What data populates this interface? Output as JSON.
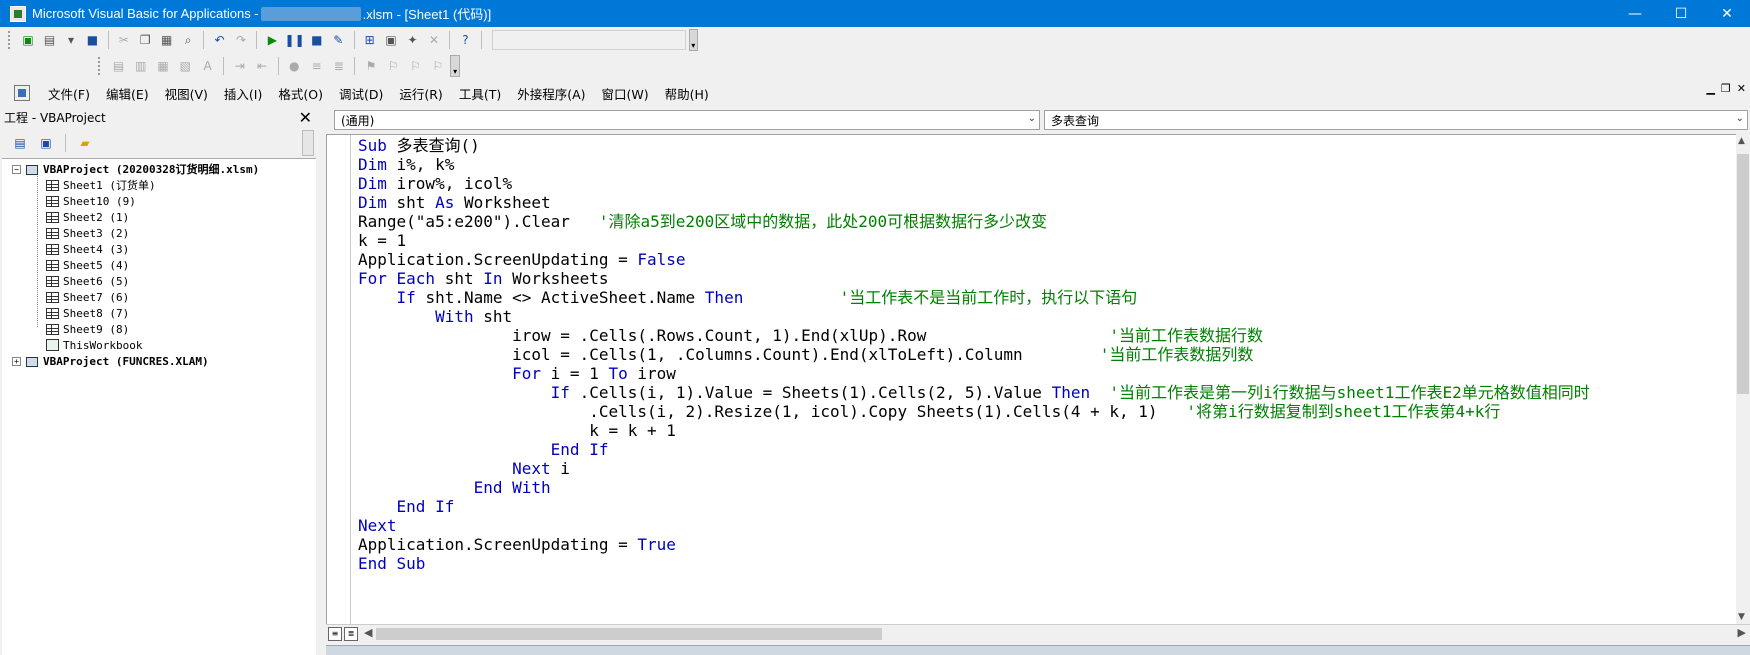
{
  "window": {
    "title_prefix": "Microsoft Visual Basic for Applications - ",
    "title_suffix": ".xlsm - [Sheet1 (代码)]",
    "min": "—",
    "max": "☐",
    "close": "✕"
  },
  "menu": {
    "items": [
      "文件(F)",
      "编辑(E)",
      "视图(V)",
      "插入(I)",
      "格式(O)",
      "调试(D)",
      "运行(R)",
      "工具(T)",
      "外接程序(A)",
      "窗口(W)",
      "帮助(H)"
    ]
  },
  "project": {
    "title": "工程 - VBAProject",
    "close": "✕",
    "root1": "VBAProject (20200328订货明细.xlsm)",
    "sheets": [
      "Sheet1 (订货单)",
      "Sheet10 (9)",
      "Sheet2 (1)",
      "Sheet3 (2)",
      "Sheet4 (3)",
      "Sheet5 (4)",
      "Sheet6 (5)",
      "Sheet7 (6)",
      "Sheet8 (7)",
      "Sheet9 (8)"
    ],
    "workbook": "ThisWorkbook",
    "root2": "VBAProject (FUNCRES.XLAM)"
  },
  "code": {
    "object_combo": "(通用)",
    "proc_combo": "多表查询",
    "lines": [
      [
        [
          "kw",
          "Sub "
        ],
        [
          "txt",
          "多表查询()"
        ]
      ],
      [
        [
          "kw",
          "Dim "
        ],
        [
          "txt",
          "i%, k%"
        ]
      ],
      [
        [
          "kw",
          "Dim "
        ],
        [
          "txt",
          "irow%, icol%"
        ]
      ],
      [
        [
          "kw",
          "Dim "
        ],
        [
          "txt",
          "sht "
        ],
        [
          "kw",
          "As "
        ],
        [
          "txt",
          "Worksheet"
        ]
      ],
      [
        [
          "txt",
          "Range(\"a5:e200\").Clear   "
        ],
        [
          "cmt",
          "'清除a5到e200区域中的数据，此处200可根据数据行多少改变"
        ]
      ],
      [
        [
          "txt",
          "k = 1"
        ]
      ],
      [
        [
          "txt",
          "Application.ScreenUpdating = "
        ],
        [
          "kw",
          "False"
        ]
      ],
      [
        [
          "kw",
          "For Each "
        ],
        [
          "txt",
          "sht "
        ],
        [
          "kw",
          "In "
        ],
        [
          "txt",
          "Worksheets"
        ]
      ],
      [
        [
          "txt",
          "    "
        ],
        [
          "kw",
          "If "
        ],
        [
          "txt",
          "sht.Name <> ActiveSheet.Name "
        ],
        [
          "kw",
          "Then"
        ],
        [
          "txt",
          "          "
        ],
        [
          "cmt",
          "'当工作表不是当前工作时，执行以下语句"
        ]
      ],
      [
        [
          "txt",
          "        "
        ],
        [
          "kw",
          "With "
        ],
        [
          "txt",
          "sht"
        ]
      ],
      [
        [
          "txt",
          "                irow = .Cells(.Rows.Count, 1).End(xlUp).Row                   "
        ],
        [
          "cmt",
          "'当前工作表数据行数"
        ]
      ],
      [
        [
          "txt",
          "                icol = .Cells(1, .Columns.Count).End(xlToLeft).Column        "
        ],
        [
          "cmt",
          "'当前工作表数据列数"
        ]
      ],
      [
        [
          "txt",
          "                "
        ],
        [
          "kw",
          "For "
        ],
        [
          "txt",
          "i = 1 "
        ],
        [
          "kw",
          "To "
        ],
        [
          "txt",
          "irow"
        ]
      ],
      [
        [
          "txt",
          "                    "
        ],
        [
          "kw",
          "If "
        ],
        [
          "txt",
          ".Cells(i, 1).Value = Sheets(1).Cells(2, 5).Value "
        ],
        [
          "kw",
          "Then"
        ],
        [
          "txt",
          "  "
        ],
        [
          "cmt",
          "'当前工作表是第一列i行数据与sheet1工作表E2单元格数值相同时"
        ]
      ],
      [
        [
          "txt",
          "                        .Cells(i, 2).Resize(1, icol).Copy Sheets(1).Cells(4 + k, 1)   "
        ],
        [
          "cmt",
          "'将第i行数据复制到sheet1工作表第4+k行"
        ]
      ],
      [
        [
          "txt",
          "                        k = k + 1"
        ]
      ],
      [
        [
          "txt",
          "                    "
        ],
        [
          "kw",
          "End If"
        ]
      ],
      [
        [
          "txt",
          "                "
        ],
        [
          "kw",
          "Next "
        ],
        [
          "txt",
          "i"
        ]
      ],
      [
        [
          "txt",
          "            "
        ],
        [
          "kw",
          "End With"
        ]
      ],
      [
        [
          "txt",
          "    "
        ],
        [
          "kw",
          "End If"
        ]
      ],
      [
        [
          "kw",
          "Next"
        ]
      ],
      [
        [
          "txt",
          "Application.ScreenUpdating = "
        ],
        [
          "kw",
          "True"
        ]
      ],
      [
        [
          "kw",
          "End Sub"
        ]
      ]
    ]
  },
  "colors": {
    "titlebar": "#0078d7",
    "keyword": "#0000c0",
    "comment": "#008000"
  }
}
